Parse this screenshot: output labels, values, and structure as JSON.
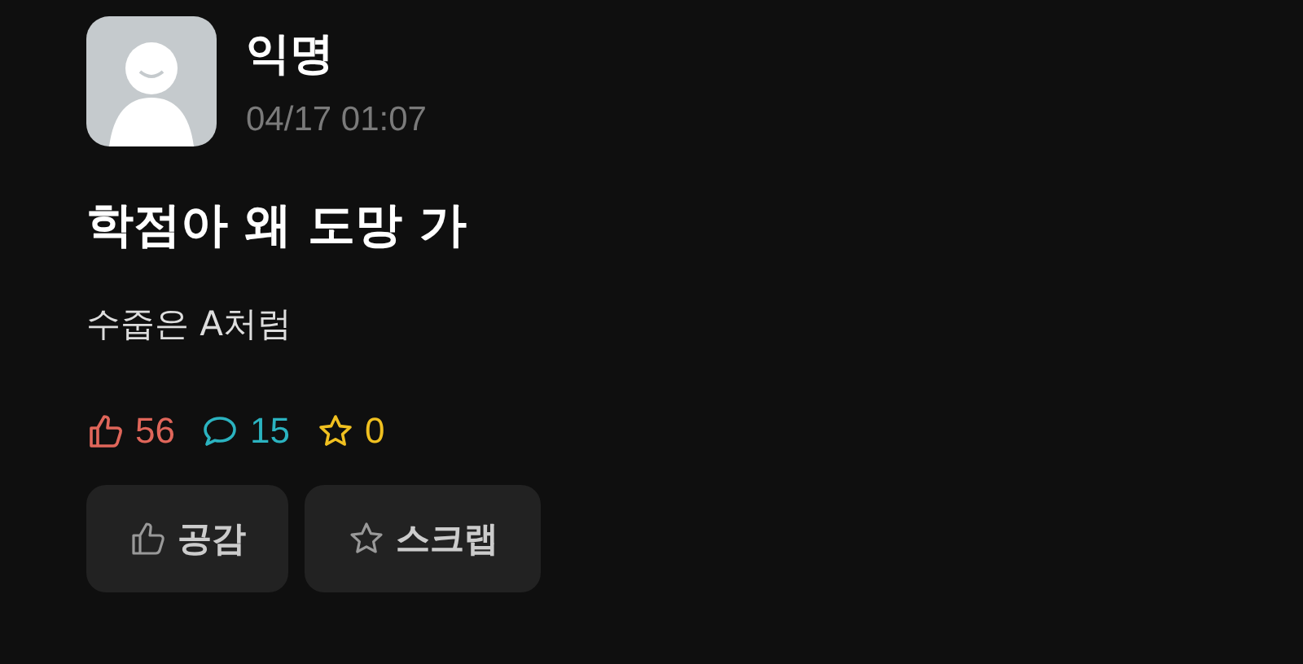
{
  "post": {
    "author": "익명",
    "time": "04/17 01:07",
    "title": "학점아 왜 도망 가",
    "body": "수줍은 A처럼"
  },
  "stats": [
    {
      "kind": "like",
      "count": "56",
      "color": "#e0665a"
    },
    {
      "kind": "comment",
      "count": "15",
      "color": "#2bb3c0"
    },
    {
      "kind": "scrap",
      "count": "0",
      "color": "#f0c020"
    }
  ],
  "buttons": [
    {
      "kind": "like",
      "label": "공감"
    },
    {
      "kind": "scrap",
      "label": "스크랩"
    }
  ]
}
